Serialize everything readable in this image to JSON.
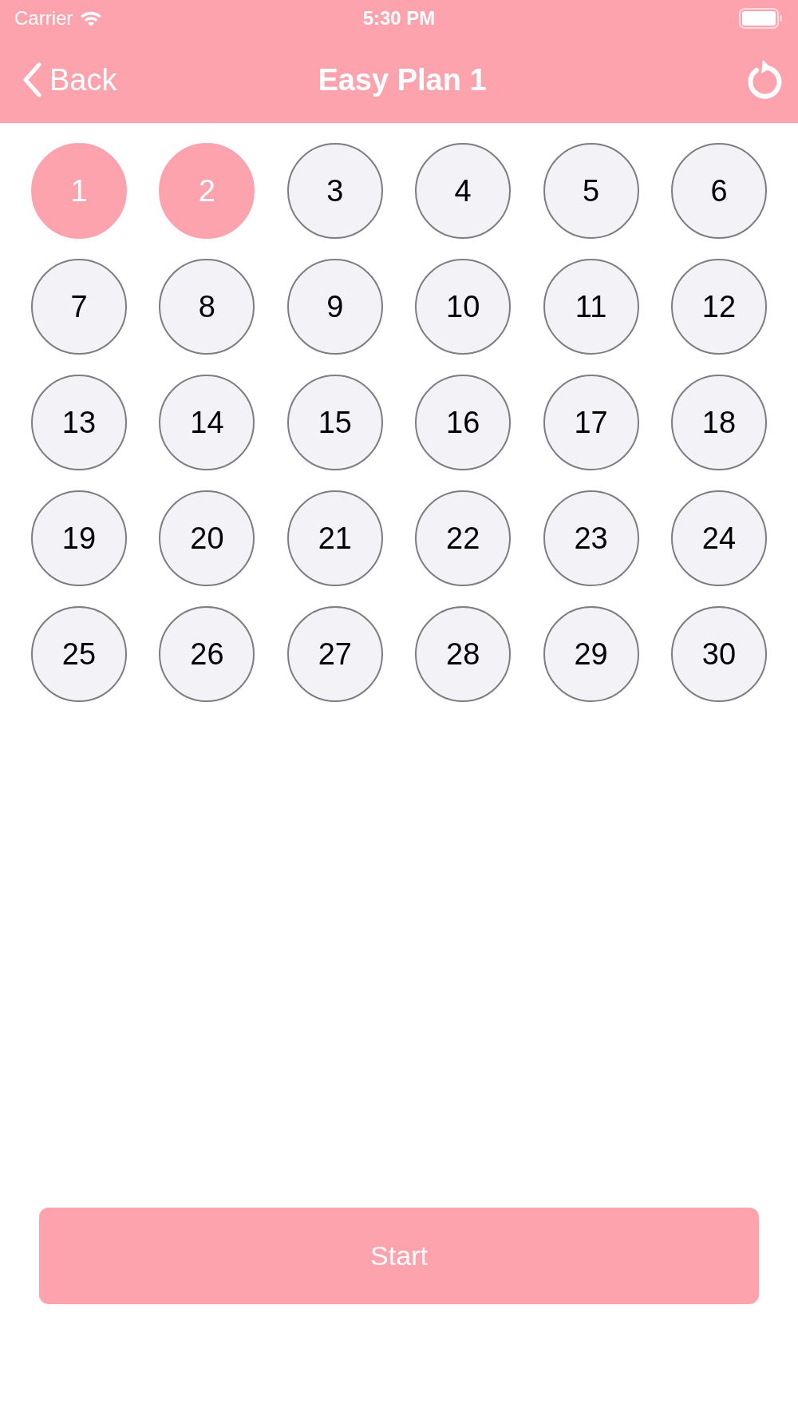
{
  "status_bar": {
    "carrier": "Carrier",
    "time": "5:30 PM"
  },
  "nav": {
    "back": "Back",
    "title": "Easy Plan 1"
  },
  "days": [
    {
      "label": "1",
      "selected": true
    },
    {
      "label": "2",
      "selected": true
    },
    {
      "label": "3",
      "selected": false
    },
    {
      "label": "4",
      "selected": false
    },
    {
      "label": "5",
      "selected": false
    },
    {
      "label": "6",
      "selected": false
    },
    {
      "label": "7",
      "selected": false
    },
    {
      "label": "8",
      "selected": false
    },
    {
      "label": "9",
      "selected": false
    },
    {
      "label": "10",
      "selected": false
    },
    {
      "label": "11",
      "selected": false
    },
    {
      "label": "12",
      "selected": false
    },
    {
      "label": "13",
      "selected": false
    },
    {
      "label": "14",
      "selected": false
    },
    {
      "label": "15",
      "selected": false
    },
    {
      "label": "16",
      "selected": false
    },
    {
      "label": "17",
      "selected": false
    },
    {
      "label": "18",
      "selected": false
    },
    {
      "label": "19",
      "selected": false
    },
    {
      "label": "20",
      "selected": false
    },
    {
      "label": "21",
      "selected": false
    },
    {
      "label": "22",
      "selected": false
    },
    {
      "label": "23",
      "selected": false
    },
    {
      "label": "24",
      "selected": false
    },
    {
      "label": "25",
      "selected": false
    },
    {
      "label": "26",
      "selected": false
    },
    {
      "label": "27",
      "selected": false
    },
    {
      "label": "28",
      "selected": false
    },
    {
      "label": "29",
      "selected": false
    },
    {
      "label": "30",
      "selected": false
    }
  ],
  "start_button": {
    "label": "Start"
  }
}
